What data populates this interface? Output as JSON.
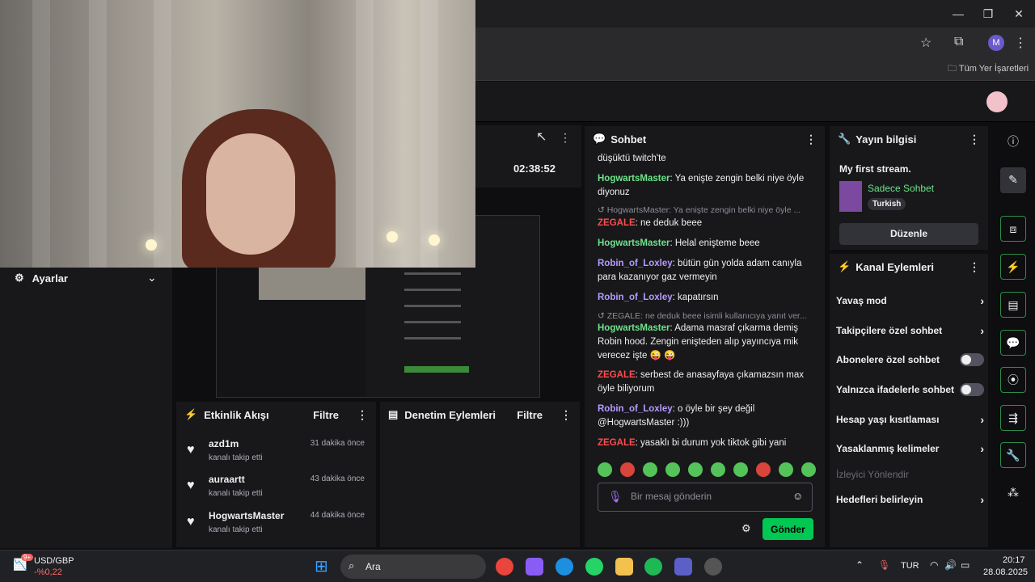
{
  "browser": {
    "bookmarks_label": "Tüm Yer İşaretleri",
    "profile_initial": "M"
  },
  "settings_panel": {
    "title": "Ayarlar"
  },
  "stream_panel": {
    "uptime": "02:38:52"
  },
  "activity_feed": {
    "title": "Etkinlik Akışı",
    "filter_label": "Filtre",
    "items": [
      {
        "user": "azd1m",
        "desc": "kanalı takip etti",
        "time": "31 dakika önce"
      },
      {
        "user": "auraartt",
        "desc": "kanalı takip etti",
        "time": "43 dakika önce"
      },
      {
        "user": "HogwartsMaster",
        "desc": "kanalı takip etti",
        "time": "44 dakika önce"
      }
    ]
  },
  "mod_actions": {
    "title": "Denetim Eylemleri",
    "filter_label": "Filtre"
  },
  "chat": {
    "title": "Sohbet",
    "messages": {
      "m0_text": "düşüktü twitch'te",
      "m1_user": "HogwartsMaster",
      "m1_text": ": Ya enişte zengin belki niye öyle diyonuz",
      "r1": "HogwartsMaster: Ya enişte zengin belki niye öyle ...",
      "m2_user": "ZEGALE",
      "m2_text": ": ne deduk beee",
      "m3_user": "HogwartsMaster",
      "m3_text": ": Helal enişteme beee",
      "m4_user": "Robin_of_Loxley",
      "m4_text": ": bütün gün yolda adam canıyla para kazanıyor gaz vermeyin",
      "m5_user": "Robin_of_Loxley",
      "m5_text": ": kapatırsın",
      "r2": "ZEGALE: ne deduk beee isimli kullanıcıya yanıt ver...",
      "m6_user": "HogwartsMaster",
      "m6_text": ": Adama masraf çıkarma demiş Robin hood. Zengin enişteden alıp yayıncıya mik verecez işte 😜 😜",
      "m7_user": "ZEGALE",
      "m7_text": ": serbest de anasayfaya çıkamazsın max öyle biliyorum",
      "m8_user": "Robin_of_Loxley",
      "m8_text": ": o öyle bir şey değil @HogwartsMaster :)))",
      "m9_user": "ZEGALE",
      "m9_text": ": yasaklı bi durum yok tiktok gibi yani"
    },
    "input_placeholder": "Bir mesaj gönderin",
    "send_label": "Gönder"
  },
  "stream_info": {
    "title": "Yayın bilgisi",
    "stream_title": "My first stream.",
    "category": "Sadece Sohbet",
    "tag": "Turkish",
    "edit_label": "Düzenle"
  },
  "channel_actions": {
    "title": "Kanal Eylemleri",
    "slow_mode": "Yavaş mod",
    "followers_only": "Takipçilere özel sohbet",
    "subs_only": "Abonelere özel sohbet",
    "emote_only": "Yalnızca ifadelerle sohbet",
    "age_restriction": "Hesap yaşı kısıtlaması",
    "banned_words": "Yasaklanmış kelimeler",
    "viewer_guide": "İzleyici Yönlendir",
    "goals": "Hedefleri belirleyin"
  },
  "taskbar": {
    "ticker_symbol": "USD/GBP",
    "ticker_change": "-%0,22",
    "ticker_badge": "9+",
    "search_label": "Ara",
    "language": "TUR",
    "time": "20:17",
    "date": "28.08.2025"
  },
  "colors": {
    "accent": "#00c853",
    "brand_purple": "#9147ff"
  }
}
